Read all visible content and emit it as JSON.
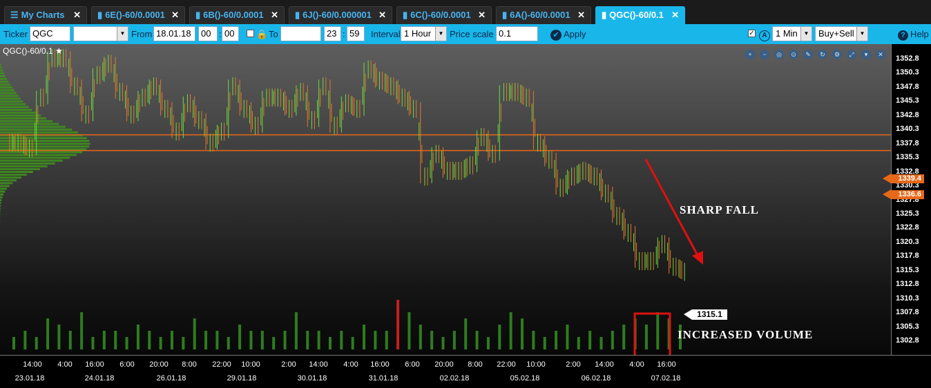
{
  "tabs": [
    {
      "label": "My Charts",
      "icon": "menu-icon",
      "active": false
    },
    {
      "label": "6E()-60/0.0001",
      "icon": "chart-icon",
      "active": false
    },
    {
      "label": "6B()-60/0.0001",
      "icon": "chart-icon",
      "active": false
    },
    {
      "label": "6J()-60/0.000001",
      "icon": "chart-icon",
      "active": false
    },
    {
      "label": "6C()-60/0.0001",
      "icon": "chart-icon",
      "active": false
    },
    {
      "label": "6A()-60/0.0001",
      "icon": "chart-icon",
      "active": false
    },
    {
      "label": "QGC()-60/0.1",
      "icon": "chart-icon",
      "active": true
    }
  ],
  "toolbar": {
    "ticker_label": "Ticker",
    "ticker_value": "QGC",
    "from_label": "From",
    "from_date": "18.01.18",
    "from_hour": "00",
    "from_min": "00",
    "to_label": "To",
    "to_hour": "23",
    "to_min": "59",
    "interval_label": "Interval",
    "interval_value": "1 Hour",
    "price_scale_label": "Price scale",
    "price_scale_value": "0.1",
    "apply_label": "Apply",
    "tf_value": "1 Min",
    "side_value": "Buy+Sell",
    "help_label": "Help"
  },
  "chart": {
    "symbol": "QGC()-60/0.1",
    "annotation_fall": "SHARP FALL",
    "annotation_volume": "INCREASED VOLUME",
    "last_price": "1315.1",
    "level_1": "1339.4",
    "level_2": "1336.6",
    "colors": {
      "up": "#6ddc3c",
      "down": "#e07a2a",
      "level": "#e8681a",
      "arrow": "#e01010",
      "box": "#e01010"
    }
  },
  "y_ticks": [
    "1352.8",
    "1350.3",
    "1347.8",
    "1345.3",
    "1342.8",
    "1340.3",
    "1337.8",
    "1335.3",
    "1332.8",
    "1330.3",
    "1327.8",
    "1325.3",
    "1322.8",
    "1320.3",
    "1317.8",
    "1315.3",
    "1312.8",
    "1310.3",
    "1307.8",
    "1305.3",
    "1302.8"
  ],
  "x_ticks": [
    "14:00",
    "4:00",
    "16:00",
    "6:00",
    "20:00",
    "8:00",
    "22:00",
    "10:00",
    "2:00",
    "14:00",
    "4:00",
    "16:00",
    "6:00",
    "20:00",
    "8:00",
    "22:00",
    "10:00",
    "2:00",
    "14:00",
    "4:00",
    "16:00"
  ],
  "x_dates": [
    "23.01.18",
    "24.01.18",
    "26.01.18",
    "29.01.18",
    "30.01.18",
    "31.01.18",
    "02.02.18",
    "05.02.18",
    "06.02.18",
    "07.02.18"
  ],
  "chart_data": {
    "type": "line",
    "title": "QGC()-60/0.1",
    "xlabel": "",
    "ylabel": "",
    "ylim": [
      1301,
      1355
    ],
    "series": [
      {
        "values": [
          1338,
          1337,
          1346,
          1353,
          1353,
          1348,
          1343,
          1350,
          1352,
          1347,
          1343,
          1346,
          1348,
          1344,
          1340,
          1345,
          1342,
          1338,
          1340,
          1348,
          1344,
          1341,
          1346,
          1346,
          1344,
          1347,
          1342,
          1348,
          1341,
          1345,
          1344,
          1351,
          1349,
          1348,
          1346,
          1344,
          1332,
          1336,
          1333,
          1333,
          1334,
          1339,
          1336,
          1347,
          1347,
          1346,
          1338,
          1335,
          1330,
          1332,
          1333,
          1332,
          1329,
          1325,
          1322,
          1317,
          1317,
          1320,
          1316,
          1315.1
        ]
      }
    ],
    "volume": [
      2,
      3,
      2,
      5,
      4,
      3,
      6,
      2,
      3,
      3,
      2,
      4,
      3,
      2,
      3,
      2,
      5,
      3,
      3,
      2,
      4,
      3,
      3,
      2,
      3,
      6,
      3,
      3,
      2,
      3,
      2,
      4,
      3,
      3,
      8,
      6,
      4,
      3,
      2,
      3,
      5,
      3,
      2,
      4,
      6,
      5,
      3,
      2,
      3,
      4,
      2,
      3,
      2,
      3,
      4,
      5,
      4,
      6,
      5,
      4
    ],
    "volume_color": "#2e7d1e",
    "volume_spike_color": "#c81e1e",
    "grid": false,
    "horizontal_lines": [
      1339.4,
      1336.6
    ]
  }
}
